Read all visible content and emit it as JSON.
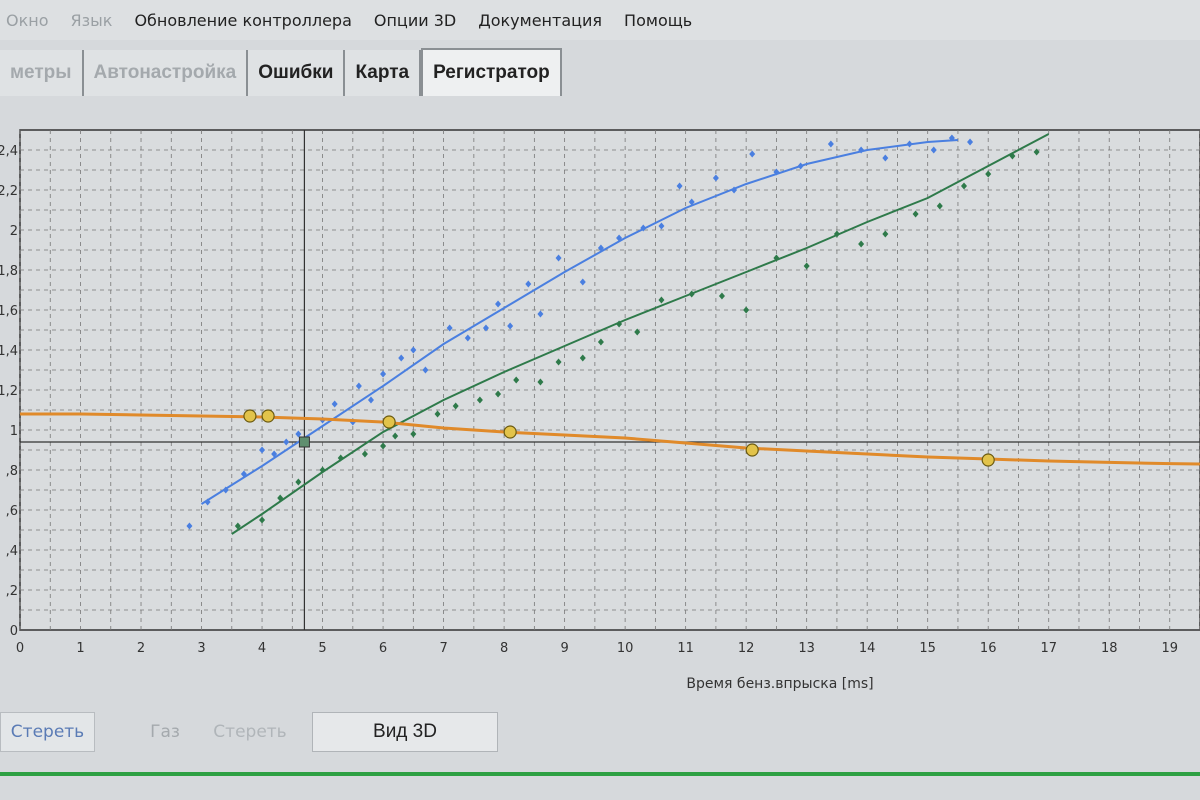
{
  "menu": {
    "items": [
      {
        "label": "Окно",
        "dim": true
      },
      {
        "label": "Язык",
        "dim": true
      },
      {
        "label": "Обновление контроллера",
        "dim": false
      },
      {
        "label": "Опции 3D",
        "dim": false
      },
      {
        "label": "Документация",
        "dim": false
      },
      {
        "label": "Помощь",
        "dim": false
      }
    ]
  },
  "tabs": [
    {
      "label": "метры",
      "dim": true,
      "active": false
    },
    {
      "label": "Автонастройка",
      "dim": true,
      "active": false
    },
    {
      "label": "Ошибки",
      "dim": false,
      "active": false
    },
    {
      "label": "Карта",
      "dim": false,
      "active": false
    },
    {
      "label": "Регистратор",
      "dim": false,
      "active": true
    }
  ],
  "chart_data": {
    "type": "scatter",
    "xlabel": "Время бенз.впрыска [ms]",
    "ylabel": "",
    "xlim": [
      0,
      19.5
    ],
    "ylim": [
      0,
      2.5
    ],
    "x_ticks": [
      0,
      1,
      2,
      3,
      4,
      5,
      6,
      7,
      8,
      9,
      10,
      11,
      12,
      13,
      14,
      15,
      16,
      17,
      18,
      19
    ],
    "y_ticks": [
      {
        "value": 0,
        "label": "0"
      },
      {
        "value": 0.2,
        "label": ",2"
      },
      {
        "value": 0.4,
        "label": ",4"
      },
      {
        "value": 0.6,
        "label": ",6"
      },
      {
        "value": 0.8,
        "label": ",8"
      },
      {
        "value": 1.0,
        "label": "1"
      },
      {
        "value": 1.2,
        "label": "1,2"
      },
      {
        "value": 1.4,
        "label": "1,4"
      },
      {
        "value": 1.6,
        "label": "1,6"
      },
      {
        "value": 1.8,
        "label": "1,8"
      },
      {
        "value": 2.0,
        "label": "2"
      },
      {
        "value": 2.2,
        "label": "2,2"
      },
      {
        "value": 2.4,
        "label": "2,4"
      }
    ],
    "grid": true,
    "reference_lines": {
      "horizontal_y": 0.94,
      "vertical_x": 4.7
    },
    "series": [
      {
        "color": "#4a7fe0",
        "kind": "line",
        "x": [
          3,
          4,
          5,
          6,
          7,
          8,
          9,
          10,
          11,
          12,
          13,
          14,
          15,
          15.5
        ],
        "y": [
          0.63,
          0.82,
          1.02,
          1.22,
          1.43,
          1.61,
          1.79,
          1.96,
          2.11,
          2.23,
          2.33,
          2.4,
          2.44,
          2.45
        ]
      },
      {
        "color": "#4a7fe0",
        "kind": "points",
        "x": [
          2.8,
          3.1,
          3.4,
          3.7,
          4.0,
          4.2,
          4.4,
          4.6,
          5.0,
          5.2,
          5.5,
          5.6,
          5.8,
          6.0,
          6.3,
          6.5,
          6.7,
          7.1,
          7.4,
          7.7,
          7.9,
          8.1,
          8.4,
          8.6,
          8.9,
          9.3,
          9.6,
          9.9,
          10.3,
          10.6,
          10.9,
          11.1,
          11.5,
          11.8,
          12.1,
          12.5,
          12.9,
          13.4,
          13.9,
          14.3,
          14.7,
          15.1,
          15.4,
          15.7
        ],
        "y": [
          0.52,
          0.64,
          0.7,
          0.78,
          0.9,
          0.88,
          0.94,
          0.98,
          1.05,
          1.13,
          1.04,
          1.22,
          1.15,
          1.28,
          1.36,
          1.4,
          1.3,
          1.51,
          1.46,
          1.51,
          1.63,
          1.52,
          1.73,
          1.58,
          1.86,
          1.74,
          1.91,
          1.96,
          2.01,
          2.02,
          2.22,
          2.14,
          2.26,
          2.2,
          2.38,
          2.29,
          2.32,
          2.43,
          2.4,
          2.36,
          2.43,
          2.4,
          2.46,
          2.44
        ]
      },
      {
        "color": "#2e7a4a",
        "kind": "line",
        "x": [
          3.5,
          4,
          5,
          6,
          7,
          8,
          9,
          10,
          11,
          12,
          13,
          14,
          15,
          16,
          17
        ],
        "y": [
          0.48,
          0.58,
          0.79,
          0.99,
          1.15,
          1.29,
          1.42,
          1.55,
          1.67,
          1.79,
          1.91,
          2.04,
          2.16,
          2.32,
          2.48
        ]
      },
      {
        "color": "#2e7a4a",
        "kind": "points",
        "x": [
          3.6,
          4.0,
          4.3,
          4.6,
          5.0,
          5.3,
          5.7,
          6.0,
          6.2,
          6.5,
          6.9,
          7.2,
          7.6,
          7.9,
          8.2,
          8.6,
          8.9,
          9.3,
          9.6,
          9.9,
          10.2,
          10.6,
          11.1,
          11.6,
          12.0,
          12.5,
          13.0,
          13.5,
          13.9,
          14.3,
          14.8,
          15.2,
          15.6,
          16.0,
          16.4,
          16.8
        ],
        "y": [
          0.52,
          0.55,
          0.66,
          0.74,
          0.8,
          0.86,
          0.88,
          0.92,
          0.97,
          0.98,
          1.08,
          1.12,
          1.15,
          1.18,
          1.25,
          1.24,
          1.34,
          1.36,
          1.44,
          1.53,
          1.49,
          1.65,
          1.68,
          1.67,
          1.6,
          1.86,
          1.82,
          1.98,
          1.93,
          1.98,
          2.08,
          2.12,
          2.22,
          2.28,
          2.37,
          2.39
        ]
      },
      {
        "color": "#e08a2a",
        "kind": "line",
        "x": [
          0,
          1,
          2,
          3,
          4,
          5,
          6,
          7,
          8,
          9,
          10,
          11,
          12,
          13,
          14,
          15,
          16,
          17,
          18,
          19,
          19.5
        ],
        "y": [
          1.08,
          1.08,
          1.075,
          1.07,
          1.065,
          1.055,
          1.04,
          1.01,
          0.99,
          0.975,
          0.96,
          0.935,
          0.91,
          0.895,
          0.88,
          0.865,
          0.855,
          0.845,
          0.838,
          0.832,
          0.83
        ]
      },
      {
        "color": "#e2c34a",
        "kind": "markers",
        "x": [
          3.8,
          4.1,
          6.1,
          8.1,
          12.1,
          16.0
        ],
        "y": [
          1.07,
          1.07,
          1.04,
          0.99,
          0.9,
          0.85
        ]
      }
    ]
  },
  "bottom": {
    "clear_label": "Стереть",
    "gas_label": "Газ",
    "erase_label": "Стереть",
    "view3d_label": "Вид 3D"
  }
}
